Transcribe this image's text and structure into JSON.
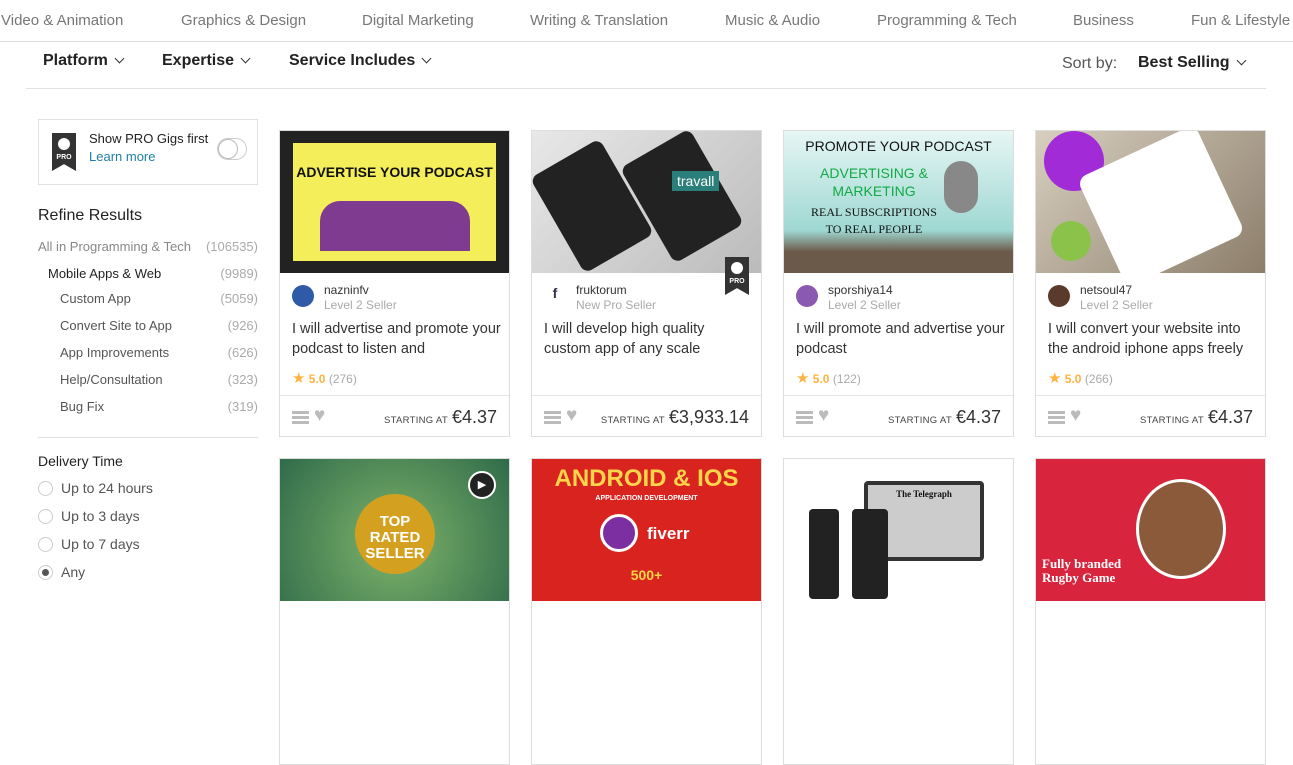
{
  "topnav": [
    "Video & Animation",
    "Graphics & Design",
    "Digital Marketing",
    "Writing & Translation",
    "Music & Audio",
    "Programming & Tech",
    "Business",
    "Fun & Lifestyle"
  ],
  "filters": {
    "platform": "Platform",
    "expertise": "Expertise",
    "service": "Service Includes",
    "sort_label": "Sort by:",
    "sort_value": "Best Selling"
  },
  "pro": {
    "badge": "PRO",
    "text": "Show PRO Gigs first",
    "learn": "Learn more",
    "enabled": false
  },
  "refine": {
    "title": "Refine Results",
    "items": [
      {
        "label": "All in Programming & Tech",
        "count": "(106535)"
      },
      {
        "label": "Mobile Apps & Web",
        "count": "(9989)"
      },
      {
        "label": "Custom App",
        "count": "(5059)"
      },
      {
        "label": "Convert Site to App",
        "count": "(926)"
      },
      {
        "label": "App Improvements",
        "count": "(626)"
      },
      {
        "label": "Help/Consultation",
        "count": "(323)"
      },
      {
        "label": "Bug Fix",
        "count": "(319)"
      }
    ]
  },
  "delivery": {
    "title": "Delivery Time",
    "options": [
      "Up to 24 hours",
      "Up to 3 days",
      "Up to 7 days",
      "Any"
    ],
    "selected": "Any"
  },
  "gigs": [
    {
      "seller": "nazninfv",
      "level": "Level 2 Seller",
      "title": "I will advertise and promote your podcast to listen and",
      "rating": "5.0",
      "reviews": "(276)",
      "starting": "STARTING AT",
      "price": "€4.37",
      "image_text": "ADVERTISE YOUR PODCAST"
    },
    {
      "seller": "fruktorum",
      "level": "New Pro Seller",
      "title": "I will develop high quality custom app of any scale",
      "rating": "",
      "reviews": "",
      "starting": "STARTING AT",
      "price": "€3,933.14",
      "image_text": "travall",
      "pro": "PRO"
    },
    {
      "seller": "sporshiya14",
      "level": "Level 2 Seller",
      "title": "I will promote and advertise your podcast",
      "rating": "5.0",
      "reviews": "(122)",
      "starting": "STARTING AT",
      "price": "€4.37",
      "image_text": "PROMOTE YOUR PODCAST",
      "image_text2": "ADVERTISING & MARKETING",
      "image_text3": "REAL SUBSCRIPTIONS TO REAL PEOPLE"
    },
    {
      "seller": "netsoul47",
      "level": "Level 2 Seller",
      "title": "I will convert your website into the android iphone apps freely",
      "rating": "5.0",
      "reviews": "(266)",
      "starting": "STARTING AT",
      "price": "€4.37",
      "image_text": ""
    }
  ],
  "gigs_row2": [
    {
      "image_text": "TOP RATED SELLER"
    },
    {
      "image_text": "ANDROID & IOS",
      "image_text2": "APPLICATION DEVELOPMENT",
      "image_text3": "fiverr",
      "image_text4": "500+"
    },
    {
      "image_text": "The Telegraph"
    },
    {
      "image_text": "Fully branded Rugby Game"
    }
  ]
}
